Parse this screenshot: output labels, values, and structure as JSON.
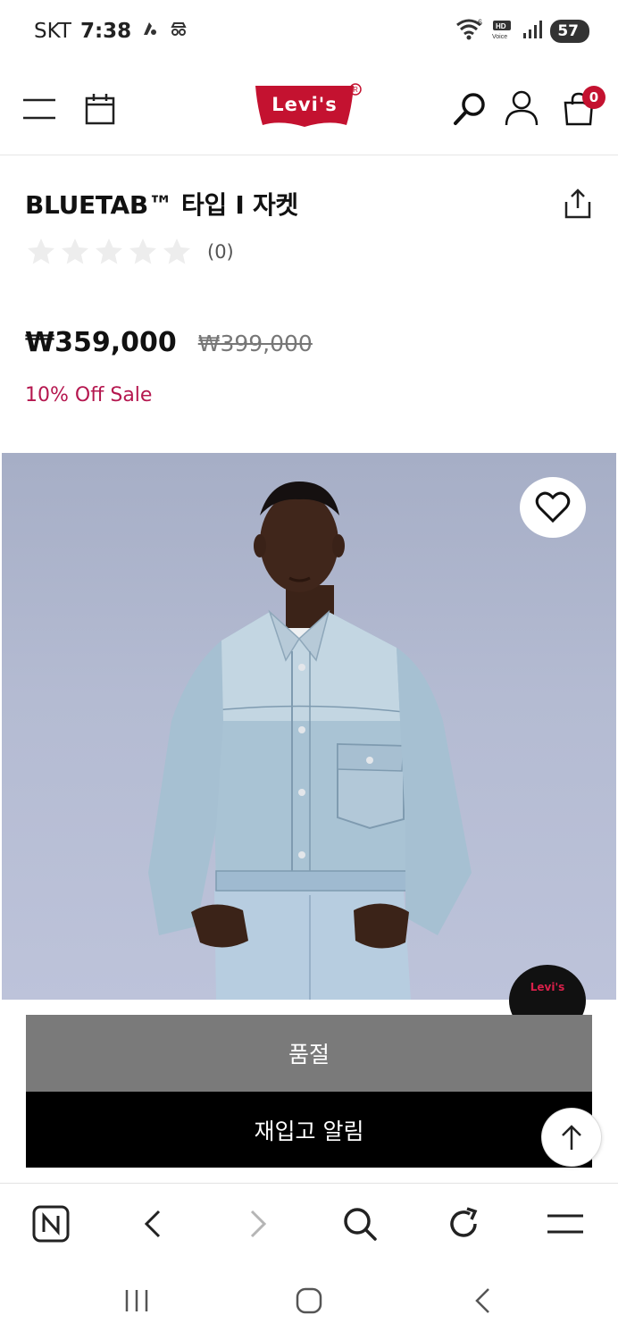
{
  "status_bar": {
    "carrier": "SKT",
    "time": "7:38",
    "battery": "57",
    "network": "HD Voice",
    "wifi_label": "6"
  },
  "header": {
    "brand": "Levi's",
    "cart_count": "0"
  },
  "product": {
    "title": "BLUETAB™ 타입 I 자켓",
    "rating_value": 0,
    "rating_max": 5,
    "review_count": "(0)",
    "price_sale": "₩359,000",
    "price_original": "₩399,000",
    "discount_label": "10% Off Sale"
  },
  "image": {
    "badge_text": "Levi's"
  },
  "actions": {
    "soldout_label": "품절",
    "restock_label": "재입고 알림"
  },
  "colors": {
    "accent": "#c41230",
    "sale_text": "#b5174f",
    "soldout_bg": "#7a7a7a",
    "restock_bg": "#000000"
  }
}
